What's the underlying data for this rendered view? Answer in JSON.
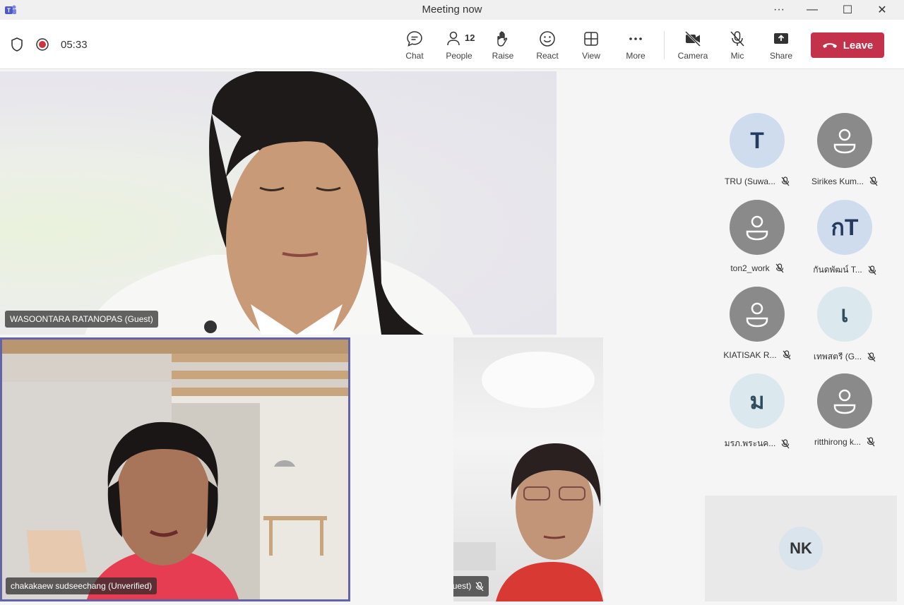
{
  "window": {
    "title": "Meeting now",
    "more_glyph": "···",
    "minimize_glyph": "—",
    "maximize_glyph": "☐",
    "close_glyph": "✕"
  },
  "toolbar": {
    "timer": "05:33",
    "chat_label": "Chat",
    "people_label": "People",
    "people_count": "12",
    "raise_label": "Raise",
    "react_label": "React",
    "view_label": "View",
    "more_label": "More",
    "camera_label": "Camera",
    "mic_label": "Mic",
    "share_label": "Share",
    "leave_label": "Leave",
    "leave_color": "#c4314b"
  },
  "videos": {
    "main": {
      "name": "WASOONTARA RATANOPAS (Guest)"
    },
    "bottom_left": {
      "name": "chakakaew sudseechang (Unverified)"
    },
    "bottom_right": {
      "name": "อ.ดร.พัฒนา นาคทอง (Guest)"
    }
  },
  "participants": [
    {
      "initials": "T",
      "name": "TRU (Suwa...",
      "style": "blue"
    },
    {
      "initials": "",
      "name": "Sirikes Kum...",
      "style": "gray"
    },
    {
      "initials": "",
      "name": "ton2_work",
      "style": "gray"
    },
    {
      "initials": "กT",
      "name": "กันดพัฒน์ T...",
      "style": "blue"
    },
    {
      "initials": "",
      "name": "KIATISAK R...",
      "style": "gray"
    },
    {
      "initials": "เ",
      "name": "เทพสตรี (G...",
      "style": "lightblue"
    },
    {
      "initials": "ม",
      "name": "มรภ.พระนค...",
      "style": "lightblue"
    },
    {
      "initials": "",
      "name": "ritthirong k...",
      "style": "gray"
    }
  ],
  "overflow_tile": {
    "initials": "NK"
  }
}
